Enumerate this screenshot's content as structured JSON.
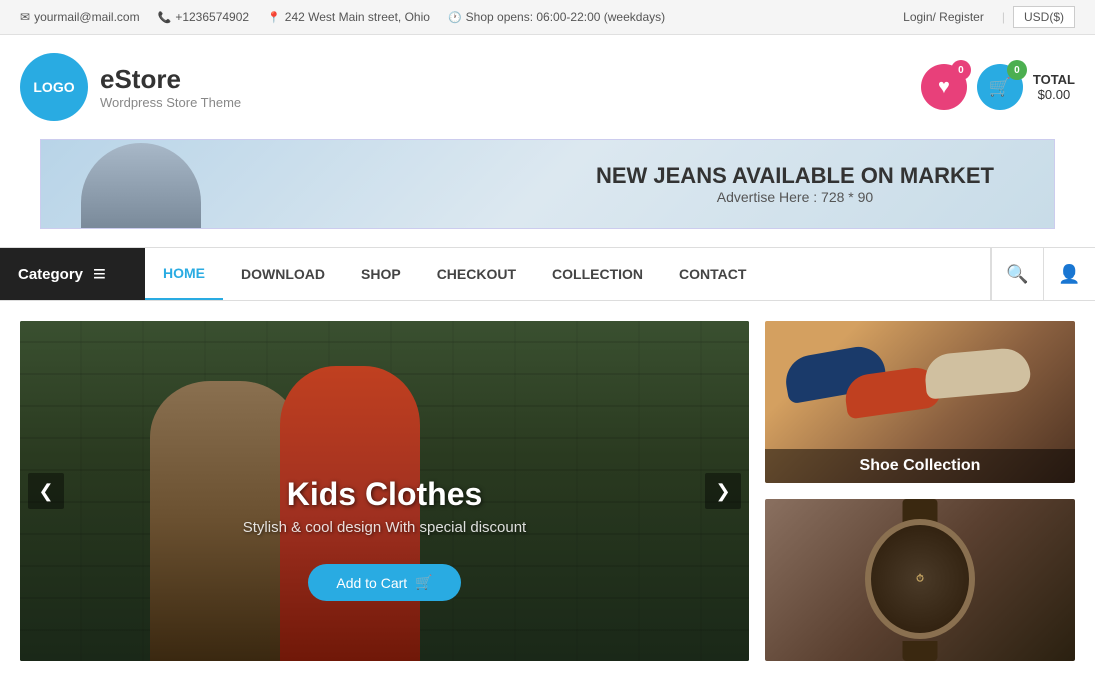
{
  "topbar": {
    "email": "yourmail@mail.com",
    "phone": "+1236574902",
    "address": "242 West Main street, Ohio",
    "hours": "Shop opens: 06:00-22:00 (weekdays)",
    "login": "Login/ Register",
    "currency": "USD($)"
  },
  "header": {
    "logo_text": "LOGO",
    "brand_name": "eStore",
    "brand_sub": "Wordpress Store Theme",
    "wishlist_count": "0",
    "cart_count": "0",
    "total_label": "TOTAL",
    "total_amount": "$0.00"
  },
  "banner": {
    "title": "NEW JEANS AVAILABLE ON MARKET",
    "subtitle": "Advertise Here : 728 * 90"
  },
  "nav": {
    "category_label": "Category",
    "links": [
      {
        "label": "HOME",
        "active": true
      },
      {
        "label": "DOWNLOAD",
        "active": false
      },
      {
        "label": "SHOP",
        "active": false
      },
      {
        "label": "CHECKOUT",
        "active": false
      },
      {
        "label": "COLLECTION",
        "active": false
      },
      {
        "label": "CONTACT",
        "active": false
      }
    ]
  },
  "slider": {
    "title": "Kids Clothes",
    "subtitle": "Stylish & cool design With special discount",
    "button_label": "Add to Cart"
  },
  "side_panels": [
    {
      "label": "Shoe Collection"
    },
    {
      "label": ""
    }
  ]
}
